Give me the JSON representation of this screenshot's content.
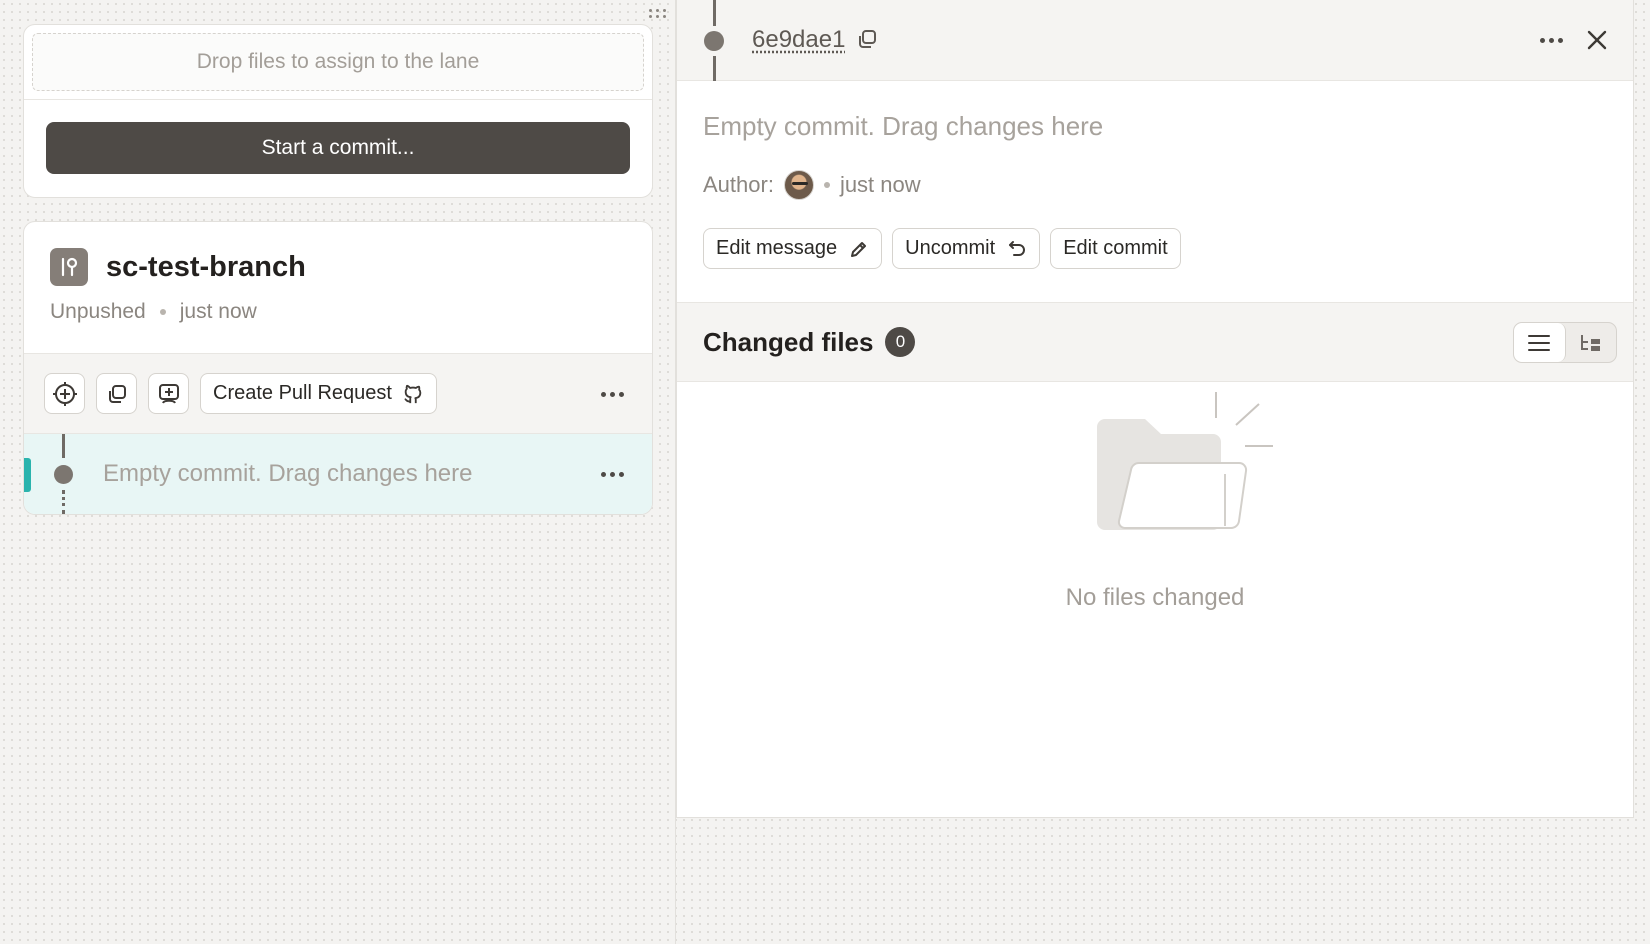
{
  "lane": {
    "drop_zone_text": "Drop files to assign to the lane",
    "start_commit_label": "Start a commit...",
    "branch": {
      "name": "sc-test-branch",
      "status": "Unpushed",
      "time": "just now",
      "create_pr_label": "Create Pull Request"
    },
    "commit": {
      "message_placeholder": "Empty commit. Drag changes here"
    }
  },
  "detail": {
    "sha": "6e9dae1",
    "message_placeholder": "Empty commit. Drag changes here",
    "author_label": "Author:",
    "author_time": "just now",
    "buttons": {
      "edit_message": "Edit message",
      "uncommit": "Uncommit",
      "edit_commit": "Edit commit"
    },
    "changed_files": {
      "title": "Changed files",
      "count": "0",
      "empty_text": "No files changed"
    }
  },
  "colors": {
    "accent_teal": "#2ab3ad",
    "primary_button": "#4e4a46",
    "selected_row": "#e8f6f5"
  }
}
